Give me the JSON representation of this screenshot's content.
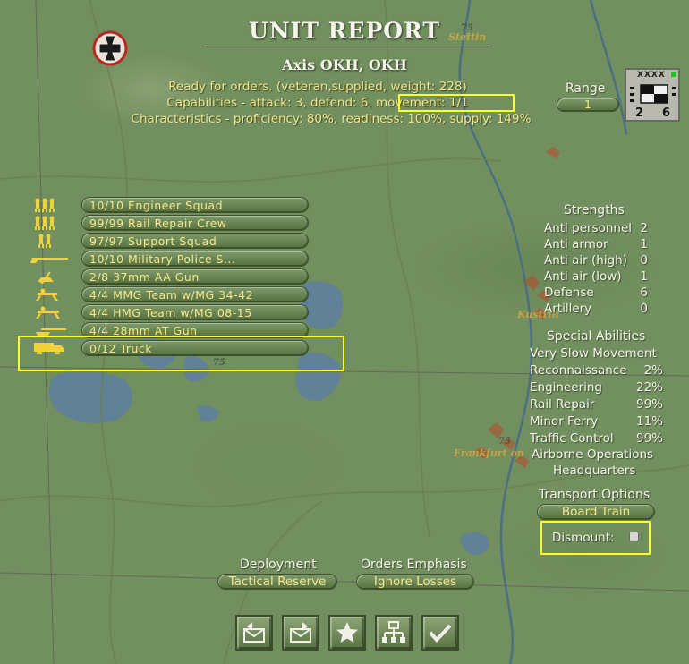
{
  "header": {
    "title": "UNIT REPORT",
    "subtitle": "Axis OKH, OKH"
  },
  "info": {
    "status_line": "Ready for orders. (veteran,supplied, weight: 228)",
    "capabilities_line": "Capabilities - attack: 3, defend: 6, movement: 1/1",
    "characteristics_line": "Characteristics - proficiency: 80%, readiness: 100%, supply: 149%"
  },
  "range": {
    "label": "Range",
    "value": "1"
  },
  "counter": {
    "size": "XXXX",
    "attack": "2",
    "defense": "6"
  },
  "components": [
    {
      "text": "10/10 Engineer Squad",
      "icon": "infantry-squad-icon"
    },
    {
      "text": "99/99 Rail Repair Crew",
      "icon": "infantry-squad-icon"
    },
    {
      "text": "97/97 Support Squad",
      "icon": "infantry-squad-icon"
    },
    {
      "text": "10/10 Military Police S...",
      "icon": "rifle-icon"
    },
    {
      "text": "2/8 37mm AA Gun",
      "icon": "aa-gun-icon"
    },
    {
      "text": "4/4 MMG Team w/MG 34-42",
      "icon": "machine-gun-icon"
    },
    {
      "text": "4/4 HMG Team w/MG 08-15",
      "icon": "machine-gun-icon"
    },
    {
      "text": "4/4 28mm AT Gun",
      "icon": "at-gun-icon"
    },
    {
      "text": "0/12 Truck",
      "icon": "truck-icon"
    }
  ],
  "strengths": {
    "header": "Strengths",
    "rows": [
      {
        "label": "Anti personnel",
        "value": "2"
      },
      {
        "label": "Anti armor",
        "value": "1"
      },
      {
        "label": "Anti air (high)",
        "value": "0"
      },
      {
        "label": "Anti air (low)",
        "value": "1"
      },
      {
        "label": "Defense",
        "value": "6"
      },
      {
        "label": "Artillery",
        "value": "0"
      }
    ]
  },
  "abilities": {
    "header": "Special Abilities",
    "rows": [
      {
        "label": "Very Slow Movement",
        "value": ""
      },
      {
        "label": "Reconnaissance",
        "value": "2%"
      },
      {
        "label": "Engineering",
        "value": "22%"
      },
      {
        "label": "Rail Repair",
        "value": "99%"
      },
      {
        "label": "Minor Ferry",
        "value": "11%"
      },
      {
        "label": "Traffic Control",
        "value": "99%"
      },
      {
        "label": "Airborne Operations",
        "value": ""
      },
      {
        "label": "Headquarters",
        "value": ""
      }
    ]
  },
  "transport": {
    "header": "Transport Options",
    "board_train": "Board Train",
    "dismount_label": "Dismount:",
    "dismount_checked": false
  },
  "deployment": {
    "label": "Deployment",
    "value": "Tactical Reserve"
  },
  "orders": {
    "label": "Orders Emphasis",
    "value": "Ignore Losses"
  },
  "map_labels": {
    "city1": "Stettin",
    "city2": "Kustrin",
    "city3": "Frankfurt on",
    "hex_number": "75"
  },
  "bottom_buttons": [
    {
      "name": "previous-unit-button",
      "icon": "envelope-back-icon"
    },
    {
      "name": "next-unit-button",
      "icon": "envelope-forward-icon"
    },
    {
      "name": "favorite-button",
      "icon": "star-icon"
    },
    {
      "name": "hierarchy-button",
      "icon": "org-chart-icon"
    },
    {
      "name": "ok-button",
      "icon": "checkmark-icon"
    }
  ],
  "colors": {
    "highlight": "#ffff2a",
    "accent_text": "#f2e68a",
    "map_green": "#728f5f"
  }
}
